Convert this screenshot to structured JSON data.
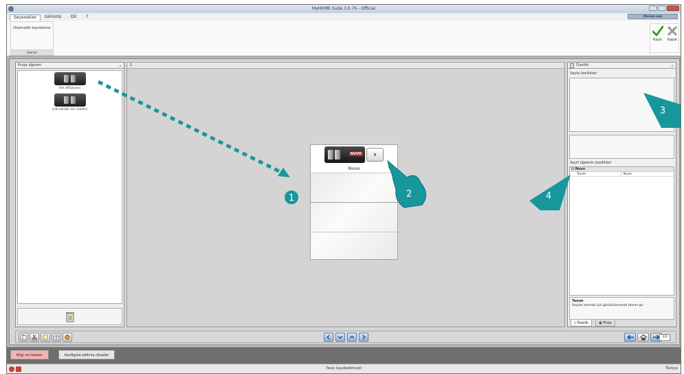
{
  "window": {
    "title": "MyHOME Suite 3.0.76 - Official"
  },
  "menu": {
    "tabs": [
      "Seçenekler",
      "Görüntü",
      "Dil",
      "?"
    ],
    "login_label": "Oturum açın"
  },
  "ribbon": {
    "group_item": "Otomatik kaydetme",
    "group_caption": "Genel",
    "save_label": "Kayd.",
    "close_label": "Kapat"
  },
  "left_panel": {
    "title": "Proje öğeleri",
    "items": [
      {
        "label": "Ses difüzyonu",
        "icon": "sound-diffusion-icon"
      },
      {
        "label": "Çok kanallı ses sistemi",
        "icon": "multichannel-sound-icon"
      }
    ]
  },
  "center_panel": {
    "tab_label": "1",
    "page": {
      "brand": "NUVO",
      "title": "Nuvo",
      "next_glyph": "›"
    }
  },
  "right_panel": {
    "title": "Özellik",
    "page_props_label": "Sayfa özellikleri",
    "selected_props_label": "Seçili öğelerin özellikleri",
    "category": "Nuvo",
    "rows": [
      {
        "key": "Tanım",
        "value": "Nuvo"
      }
    ],
    "desc_title": "Tanım",
    "desc_text": "Seçilen eleman için görüntülenecek tanımı gir",
    "tabs": [
      "Özellik",
      "Proje"
    ]
  },
  "toolbar": {
    "page_indicator": "2/3"
  },
  "status_tabs": [
    "Bilgi ve hatalar",
    "Konfigüre edilmiş cihazlar"
  ],
  "statusbar": {
    "message": "Tesis kaydedilmedi",
    "language": "Türkçe"
  },
  "annotations": {
    "numbers": [
      "1",
      "2",
      "3",
      "4"
    ],
    "color": "#17979c"
  },
  "colors": {
    "accent_teal": "#17979c",
    "active_status_tab": "#f3b3b3",
    "save_check": "#3a9a2a"
  }
}
